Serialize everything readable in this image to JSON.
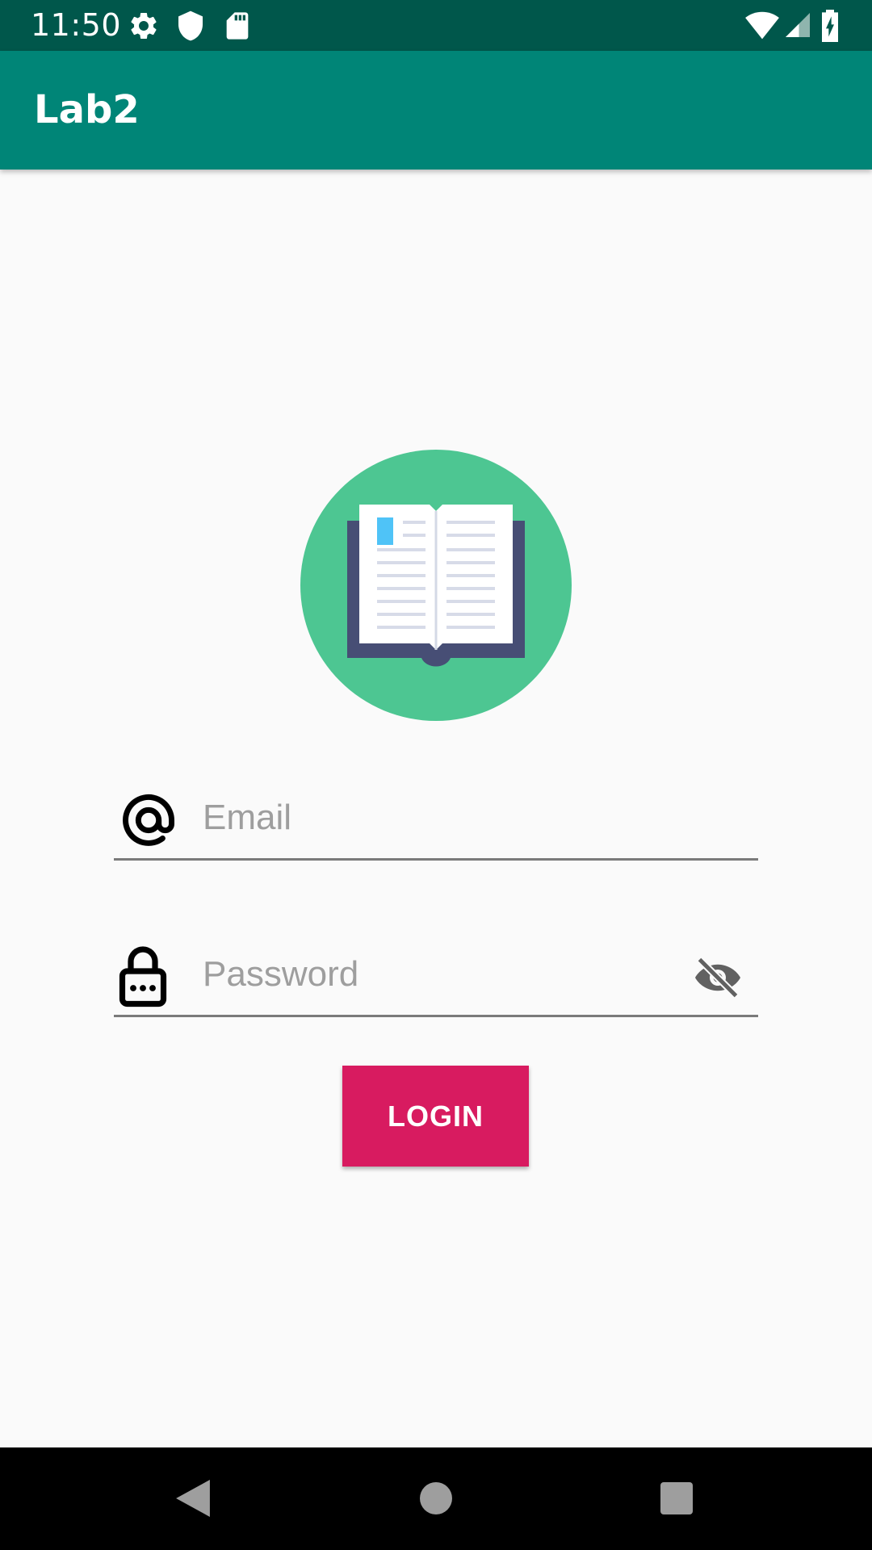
{
  "status_bar": {
    "time": "11:50",
    "left_icons": [
      "settings-icon",
      "shield-icon",
      "sd-card-icon"
    ],
    "right_icons": [
      "wifi-icon",
      "cell-signal-icon",
      "battery-charging-icon"
    ]
  },
  "app_bar": {
    "title": "Lab2"
  },
  "logo": {
    "icon": "open-book-icon",
    "circle_color": "#4dc692",
    "cover_color": "#474e75",
    "bookmark_color": "#4fc3f7"
  },
  "login_form": {
    "email": {
      "icon": "at-sign-icon",
      "placeholder": "Email",
      "value": ""
    },
    "password": {
      "icon": "lock-icon",
      "placeholder": "Password",
      "value": "",
      "toggle_icon": "visibility-off-icon"
    },
    "login_button": {
      "label": "LOGIN",
      "color": "#d81b60"
    }
  },
  "nav_bar": {
    "buttons": [
      "back-icon",
      "home-icon",
      "recents-icon"
    ]
  },
  "colors": {
    "status_bar": "#00574b",
    "app_bar": "#008577",
    "background": "#fafafa"
  }
}
